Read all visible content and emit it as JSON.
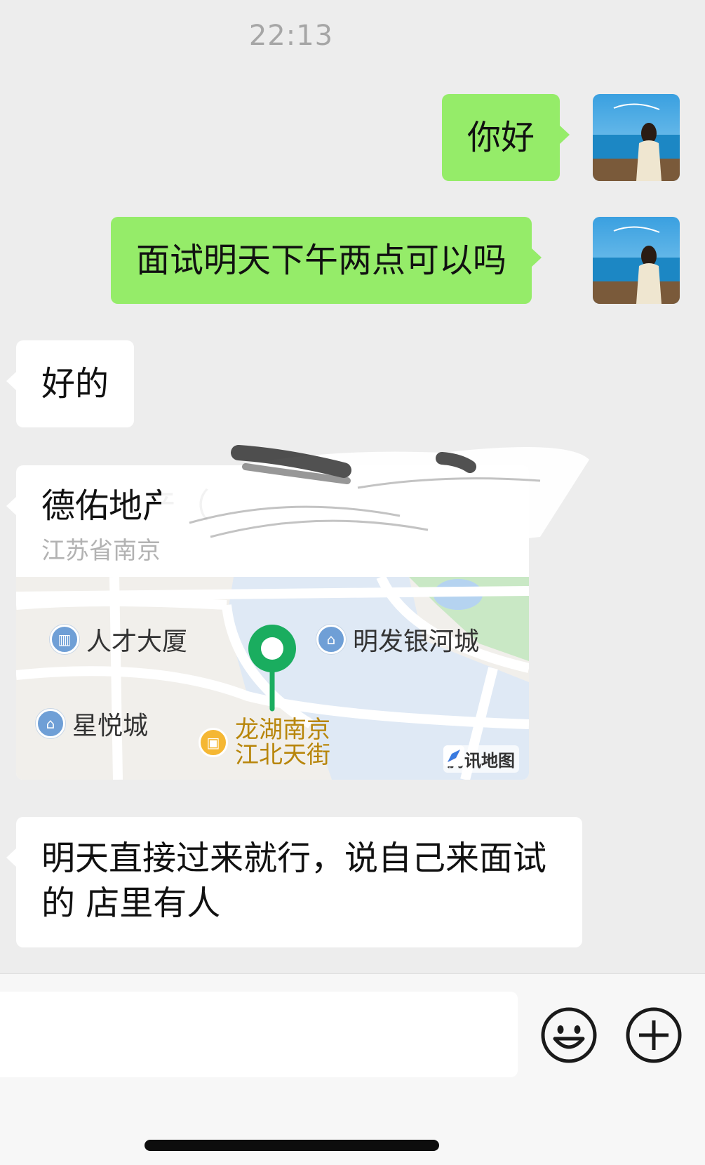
{
  "chat": {
    "timestamp": "22:13",
    "messages": [
      {
        "sender": "self",
        "type": "text",
        "text": "你好"
      },
      {
        "sender": "self",
        "type": "text",
        "text": "面试明天下午两点可以吗"
      },
      {
        "sender": "other",
        "type": "text",
        "text": "好的"
      },
      {
        "sender": "other",
        "type": "location",
        "title": "德佑地产（",
        "address": "江苏省南京",
        "map": {
          "pois": [
            "人才大厦",
            "明发银河城",
            "星悦城",
            "龙湖南京江北天街"
          ],
          "attribution": "腾讯地图"
        }
      },
      {
        "sender": "other",
        "type": "text",
        "text": "明天直接过来就行，说自己来面试的 店里有人"
      }
    ]
  },
  "input_bar": {
    "emoji_button": "emoji-icon",
    "more_button": "plus-icon"
  },
  "colors": {
    "background": "#ededed",
    "self_bubble": "#95ec69",
    "other_bubble": "#ffffff",
    "pin": "#1aad5f"
  }
}
